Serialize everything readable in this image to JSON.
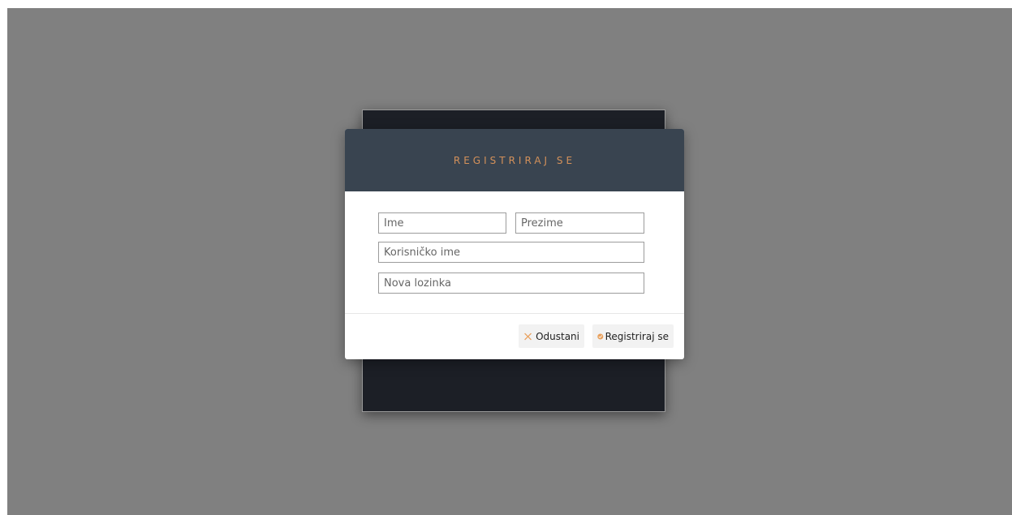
{
  "modal": {
    "title": "REGISTRIRAJ SE",
    "fields": {
      "first_name_placeholder": "Ime",
      "last_name_placeholder": "Prezime",
      "username_placeholder": "Korisničko ime",
      "password_placeholder": "Nova lozinka"
    },
    "buttons": {
      "cancel_label": "Odustani",
      "cancel_icon": "close-icon",
      "register_label": "Registriraj se",
      "register_icon": "check-circle-icon"
    }
  },
  "colors": {
    "overlay": "#808080",
    "header_bg": "#394450",
    "title_accent": "#d4915a",
    "icon_accent": "#e8a05c",
    "backdrop_card": "#1c1f26"
  }
}
